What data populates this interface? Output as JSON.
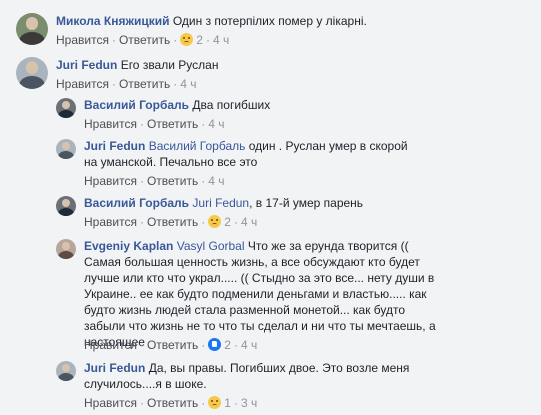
{
  "comments": [
    {
      "author": "Микола Княжицкий",
      "mention": "",
      "text": "Один з потерпілих помер у лікарні.",
      "like": "Нравится",
      "reply": "Ответить",
      "reaction": "sad-reaction-icon",
      "reaction_count": "2",
      "time": "4 ч"
    },
    {
      "author": "Juri Fedun",
      "mention": "",
      "text": "Его звали Руслан",
      "like": "Нравится",
      "reply": "Ответить",
      "reaction": "",
      "reaction_count": "",
      "time": "4 ч"
    },
    {
      "author": "Василий Горбаль",
      "mention": "",
      "text": "Два погибших",
      "like": "Нравится",
      "reply": "Ответить",
      "reaction": "",
      "reaction_count": "",
      "time": "4 ч"
    },
    {
      "author": "Juri Fedun",
      "mention": "Василий Горбаль",
      "text": "один . Руслан умер в скорой на уманской. Печально все это",
      "like": "Нравится",
      "reply": "Ответить",
      "reaction": "",
      "reaction_count": "",
      "time": "4 ч"
    },
    {
      "author": "Василий Горбаль",
      "mention": "Juri Fedun",
      "text": ", в 17-й умер парень",
      "like": "Нравится",
      "reply": "Ответить",
      "reaction": "sad-reaction-icon",
      "reaction_count": "2",
      "time": "4 ч"
    },
    {
      "author": "Evgeniy Kaplan",
      "mention": "Vasyl Gorbal",
      "text": "Что же за ерунда творится (( Самая большая ценность жизнь, а все обсуждают кто будет лучше или кто что украл..... (( Стыдно за это все... нету души в Украине.. ее как будто подменили деньгами и властью..... как будто жизнь людей стала разменной монетой... как будто забыли что жизнь не то что ты сделал и ни что ты мечтаешь, а настоящее",
      "like": "Нравится",
      "reply": "Ответить",
      "reaction": "like-reaction-icon",
      "reaction_count": "2",
      "time": "4 ч"
    },
    {
      "author": "Juri Fedun",
      "mention": "",
      "text": "Да, вы правы. Погибших двое. Это возле меня случилось....я в шоке.",
      "like": "Нравится",
      "reply": "Ответить",
      "reaction": "sad-reaction-icon",
      "reaction_count": "1",
      "time": "3 ч"
    }
  ],
  "colors": {
    "author": "#385898",
    "background": "#f2f3f5",
    "meta": "#90949c"
  }
}
